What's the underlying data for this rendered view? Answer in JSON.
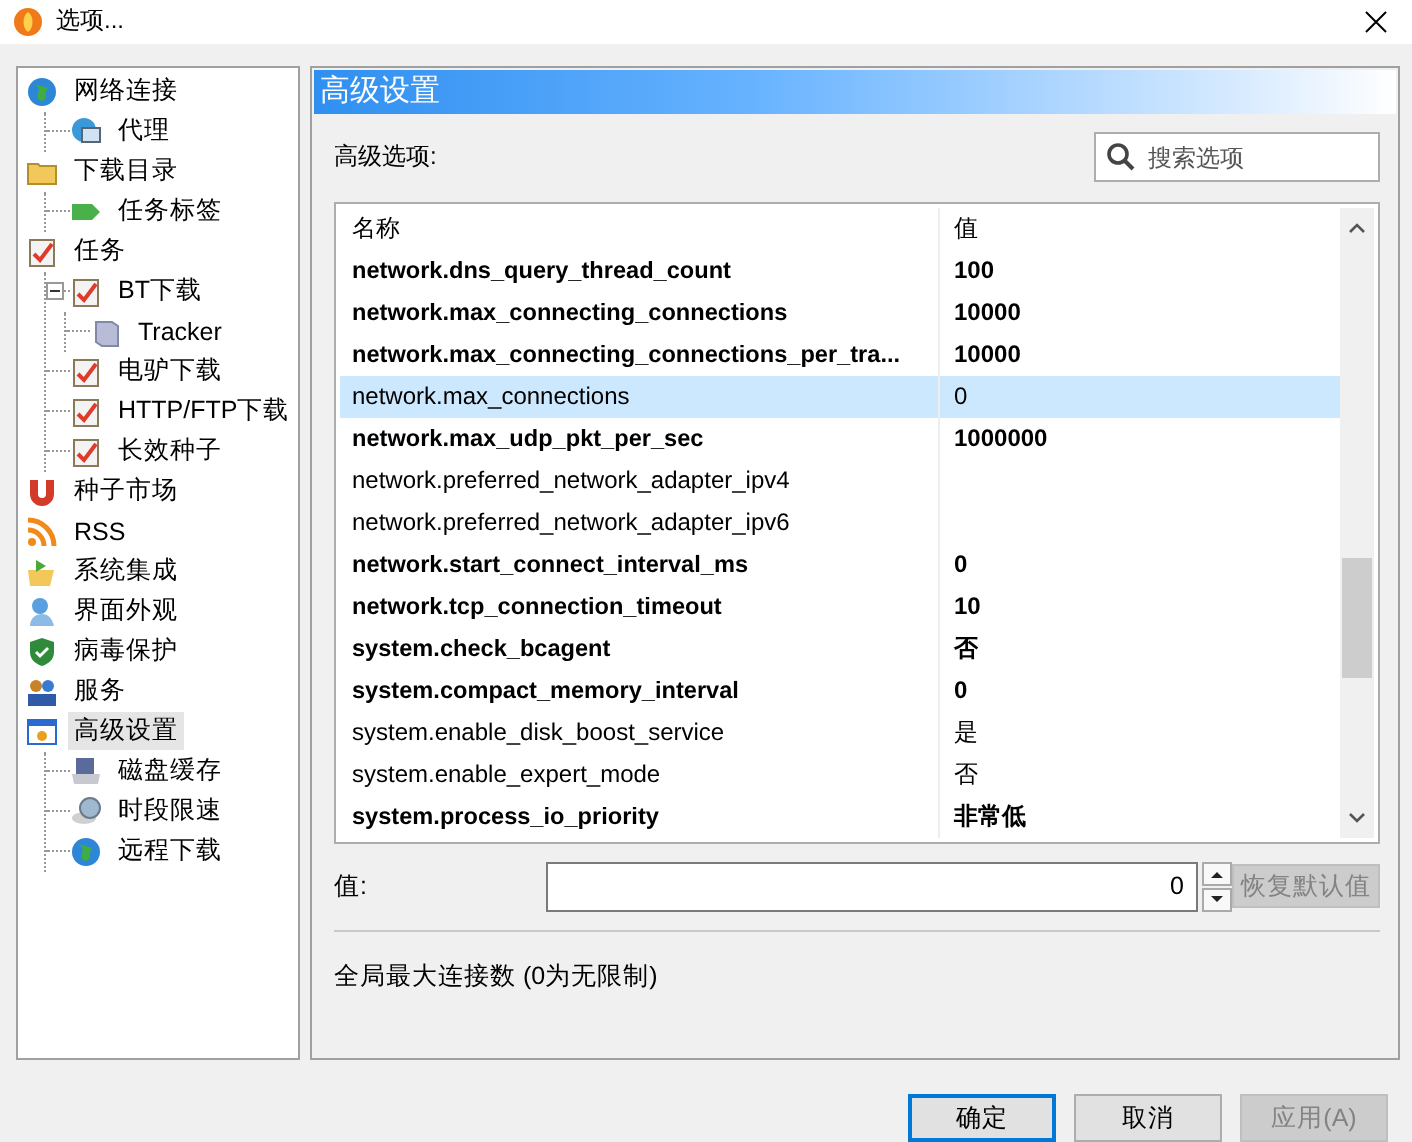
{
  "window": {
    "title": "选项..."
  },
  "sidebar": {
    "items": [
      {
        "label": "网络连接",
        "selected": false,
        "children": [
          {
            "label": "代理",
            "selected": false
          }
        ]
      },
      {
        "label": "下载目录",
        "selected": false,
        "children": [
          {
            "label": "任务标签",
            "selected": false
          }
        ]
      },
      {
        "label": "任务",
        "selected": false,
        "children": [
          {
            "label": "BT下载",
            "selected": false,
            "expanded": true,
            "children": [
              {
                "label": "Tracker",
                "selected": false
              }
            ]
          },
          {
            "label": "电驴下载",
            "selected": false
          },
          {
            "label": "HTTP/FTP下载",
            "selected": false
          },
          {
            "label": "长效种子",
            "selected": false
          }
        ]
      },
      {
        "label": "种子市场",
        "selected": false
      },
      {
        "label": "RSS",
        "selected": false
      },
      {
        "label": "系统集成",
        "selected": false
      },
      {
        "label": "界面外观",
        "selected": false
      },
      {
        "label": "病毒保护",
        "selected": false
      },
      {
        "label": "服务",
        "selected": false
      },
      {
        "label": "高级设置",
        "selected": true,
        "children": [
          {
            "label": "磁盘缓存",
            "selected": false
          },
          {
            "label": "时段限速",
            "selected": false
          },
          {
            "label": "远程下载",
            "selected": false
          }
        ]
      }
    ]
  },
  "panel": {
    "title": "高级设置",
    "section_label": "高级选项:",
    "search": {
      "placeholder": "搜索选项"
    },
    "table": {
      "columns": [
        "名称",
        "值"
      ],
      "rows": [
        {
          "name": "network.dns_query_thread_count",
          "value": "100",
          "bold": true,
          "selected": false
        },
        {
          "name": "network.max_connecting_connections",
          "value": "10000",
          "bold": true,
          "selected": false
        },
        {
          "name": "network.max_connecting_connections_per_tra...",
          "value": "10000",
          "bold": true,
          "selected": false
        },
        {
          "name": "network.max_connections",
          "value": "0",
          "bold": false,
          "selected": true
        },
        {
          "name": "network.max_udp_pkt_per_sec",
          "value": "1000000",
          "bold": true,
          "selected": false
        },
        {
          "name": "network.preferred_network_adapter_ipv4",
          "bold": false,
          "selected": false
        },
        {
          "name": "network.preferred_network_adapter_ipv6",
          "bold": false,
          "selected": false
        },
        {
          "name": "network.start_connect_interval_ms",
          "value": "0",
          "bold": true,
          "selected": false
        },
        {
          "name": "network.tcp_connection_timeout",
          "value": "10",
          "bold": true,
          "selected": false
        },
        {
          "name": "system.check_bcagent",
          "value": "否",
          "bold": true,
          "selected": false
        },
        {
          "name": "system.compact_memory_interval",
          "value": "0",
          "bold": true,
          "selected": false
        },
        {
          "name": "system.enable_disk_boost_service",
          "value": "是",
          "bold": false,
          "selected": false
        },
        {
          "name": "system.enable_expert_mode",
          "value": "否",
          "bold": false,
          "selected": false
        },
        {
          "name": "system.process_io_priority",
          "value": "非常低",
          "bold": true,
          "selected": false
        }
      ]
    },
    "value_label": "值:",
    "value": "0",
    "reset_button": {
      "label": "恢复默认值",
      "disabled": true
    },
    "description": "全局最大连接数 (0为无限制)"
  },
  "buttons": [
    {
      "label": "确定",
      "default": true,
      "disabled": false
    },
    {
      "label": "取消",
      "default": false,
      "disabled": false
    },
    {
      "label": "应用(A)",
      "default": false,
      "disabled": true
    }
  ]
}
